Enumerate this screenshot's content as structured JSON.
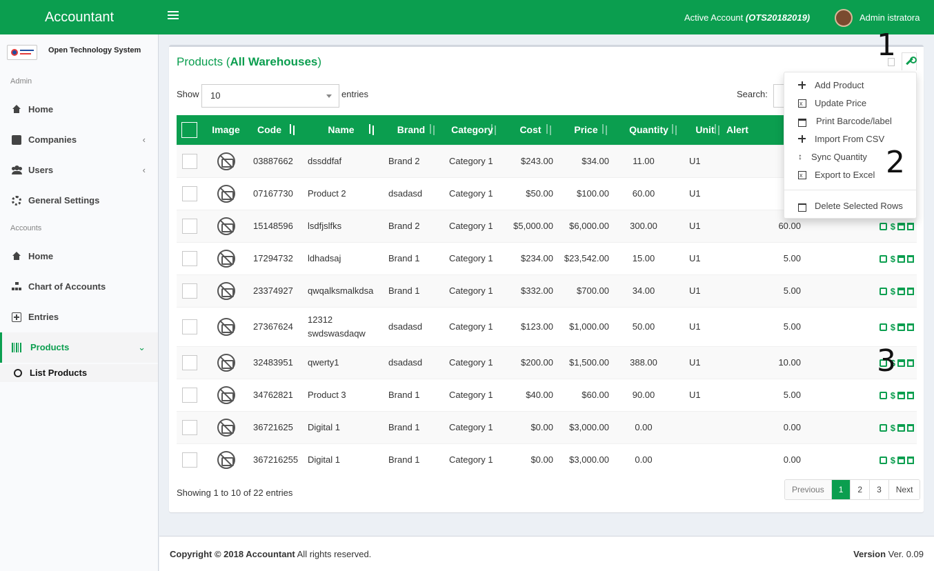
{
  "header": {
    "app_name": "Accountant",
    "active_account_label": "Active Account",
    "active_account_code": "(OTS20182019)",
    "username": "Admin istratora"
  },
  "sidebar": {
    "company": "Open Technology System",
    "section_admin": "Admin",
    "section_accounts": "Accounts",
    "items": [
      {
        "label": "Home",
        "icon": "home-icon"
      },
      {
        "label": "Companies",
        "icon": "book-icon"
      },
      {
        "label": "Users",
        "icon": "users-icon"
      },
      {
        "label": "General Settings",
        "icon": "cogs-icon"
      },
      {
        "label": "Home",
        "icon": "home-icon"
      },
      {
        "label": "Chart of Accounts",
        "icon": "sitemap-icon"
      },
      {
        "label": "Entries",
        "icon": "plus-square-icon"
      },
      {
        "label": "Products",
        "icon": "barcode-icon"
      }
    ],
    "sub_item": "List Products",
    "chevron_left": "‹",
    "chevron_down": "⌄"
  },
  "box": {
    "title_prefix": "Products (",
    "title_bold": "All Warehouses",
    "title_suffix": ")",
    "show_label": "Show",
    "show_value": "10",
    "entries_label": "entries",
    "search_label": "Search:"
  },
  "table": {
    "columns": [
      "Image",
      "Code",
      "Name",
      "Brand",
      "Category",
      "Cost",
      "Price",
      "Quantity",
      "Unit",
      "Alert"
    ],
    "rows": [
      {
        "code": "03887662",
        "name": "dssddfaf",
        "brand": "Brand 2",
        "category": "Category 1",
        "cost": "$243.00",
        "price": "$34.00",
        "quantity": "11.00",
        "unit": "U1",
        "alert": ""
      },
      {
        "code": "07167730",
        "name": "Product 2",
        "brand": "dsadasd",
        "category": "Category 1",
        "cost": "$50.00",
        "price": "$100.00",
        "quantity": "60.00",
        "unit": "U1",
        "alert": ""
      },
      {
        "code": "15148596",
        "name": "lsdfjslfks",
        "brand": "Brand 2",
        "category": "Category 1",
        "cost": "$5,000.00",
        "price": "$6,000.00",
        "quantity": "300.00",
        "unit": "U1",
        "alert": "60.00"
      },
      {
        "code": "17294732",
        "name": "ldhadsaj",
        "brand": "Brand 1",
        "category": "Category 1",
        "cost": "$234.00",
        "price": "$23,542.00",
        "quantity": "15.00",
        "unit": "U1",
        "alert": "5.00"
      },
      {
        "code": "23374927",
        "name": "qwqalksmalkdsa",
        "brand": "Brand 1",
        "category": "Category 1",
        "cost": "$332.00",
        "price": "$700.00",
        "quantity": "34.00",
        "unit": "U1",
        "alert": "5.00"
      },
      {
        "code": "27367624",
        "name": "12312 swdswasdaqw",
        "brand": "dsadasd",
        "category": "Category 1",
        "cost": "$123.00",
        "price": "$1,000.00",
        "quantity": "50.00",
        "unit": "U1",
        "alert": "5.00"
      },
      {
        "code": "32483951",
        "name": "qwerty1",
        "brand": "dsadasd",
        "category": "Category 1",
        "cost": "$200.00",
        "price": "$1,500.00",
        "quantity": "388.00",
        "unit": "U1",
        "alert": "10.00"
      },
      {
        "code": "34762821",
        "name": "Product 3",
        "brand": "Brand 1",
        "category": "Category 1",
        "cost": "$40.00",
        "price": "$60.00",
        "quantity": "90.00",
        "unit": "U1",
        "alert": "5.00"
      },
      {
        "code": "36721625",
        "name": "Digital 1",
        "brand": "Brand 1",
        "category": "Category 1",
        "cost": "$0.00",
        "price": "$3,000.00",
        "quantity": "0.00",
        "unit": "",
        "alert": "0.00"
      },
      {
        "code": "367216255",
        "name": "Digital 1",
        "brand": "Brand 1",
        "category": "Category 1",
        "cost": "$0.00",
        "price": "$3,000.00",
        "quantity": "0.00",
        "unit": "",
        "alert": "0.00"
      }
    ],
    "dollar": "$"
  },
  "footer_info": {
    "showing": "Showing 1 to 10 of 22 entries",
    "pager": [
      "Previous",
      "1",
      "2",
      "3",
      "Next"
    ]
  },
  "dropdown": {
    "items": [
      {
        "label": "Add Product",
        "icon": "plus-icon"
      },
      {
        "label": "Update Price",
        "icon": "file-excel-icon"
      },
      {
        "label": "Print Barcode/label",
        "icon": "print-icon"
      },
      {
        "label": "Import From CSV",
        "icon": "plus-icon"
      },
      {
        "label": "Sync Quantity",
        "icon": "arrows-v-icon"
      },
      {
        "label": "Export to Excel",
        "icon": "file-excel-icon"
      },
      {
        "label": "Delete Selected Rows",
        "icon": "trash-icon"
      }
    ]
  },
  "callouts": [
    "1",
    "2",
    "3"
  ],
  "footer": {
    "copyright_bold": "Copyright © 2018 Accountant",
    "copyright_rest": "All rights reserved.",
    "version_label": "Version",
    "version_value": "Ver. 0.09"
  },
  "colors": {
    "brand_green": "#0b9e4f"
  }
}
